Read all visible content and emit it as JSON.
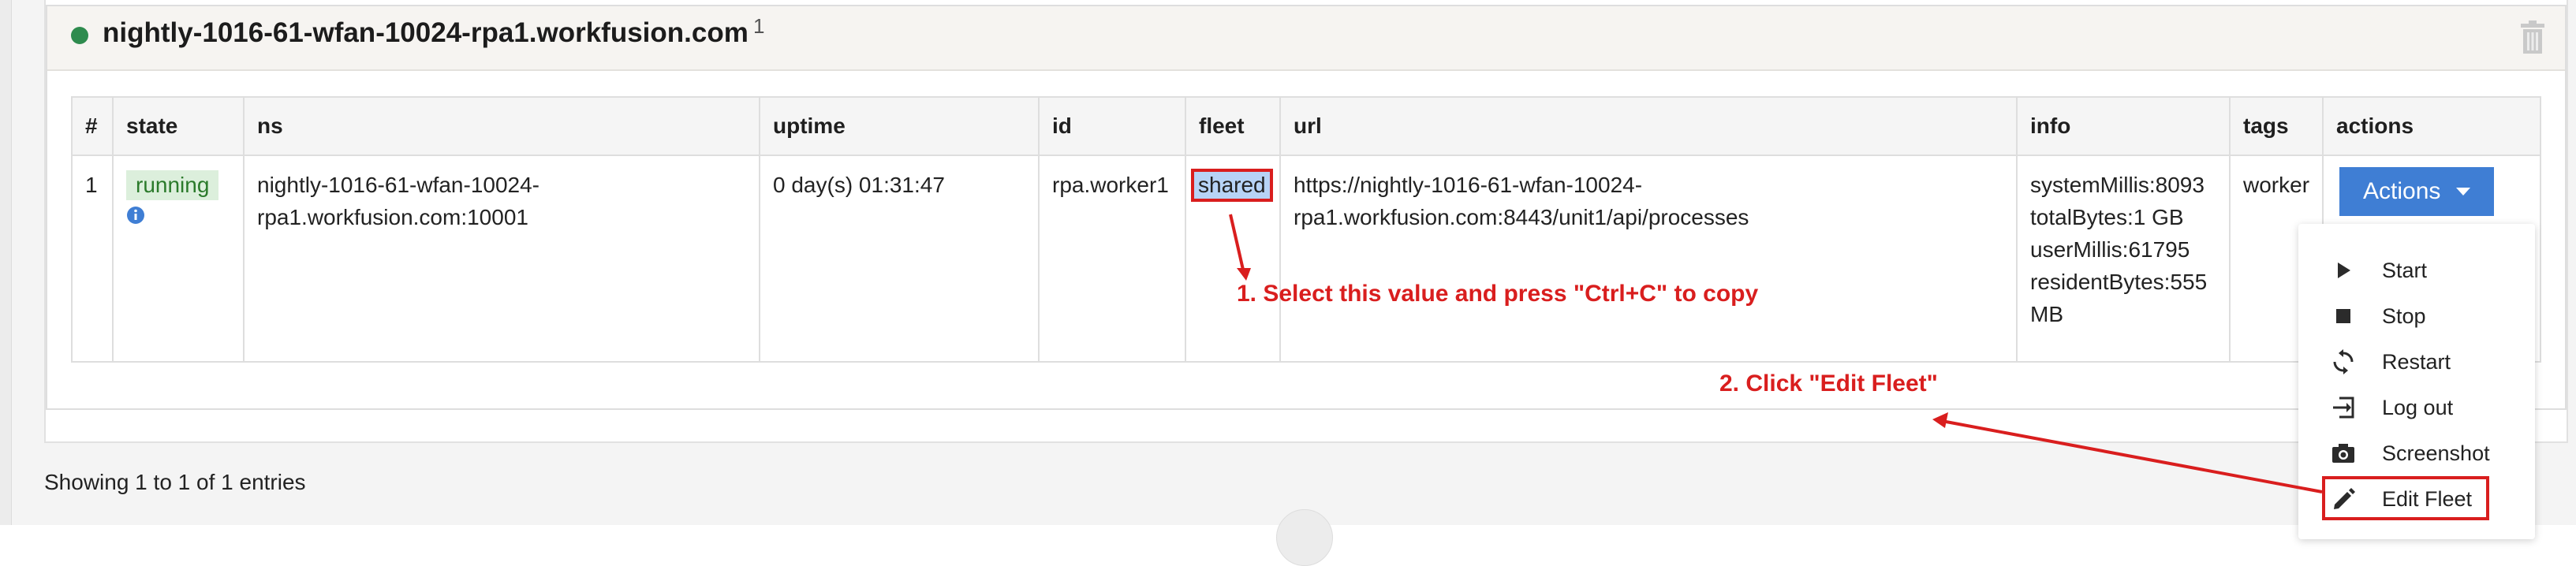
{
  "header": {
    "host": "nightly-1016-61-wfan-10024-rpa1.workfusion.com",
    "count": "1"
  },
  "table": {
    "headers": [
      "#",
      "state",
      "ns",
      "uptime",
      "id",
      "fleet",
      "url",
      "info",
      "tags",
      "actions"
    ],
    "row": {
      "num": "1",
      "state": "running",
      "ns": "nightly-1016-61-wfan-10024-rpa1.workfusion.com:10001",
      "uptime": "0 day(s) 01:31:47",
      "id": "rpa.worker1",
      "fleet": "shared",
      "url": "https://nightly-1016-61-wfan-10024-rpa1.workfusion.com:8443/unit1/api/processes",
      "info": [
        "systemMillis:8093",
        "totalBytes:1 GB",
        "userMillis:61795",
        "residentBytes:555 MB"
      ],
      "tags": "worker",
      "actions_label": "Actions"
    }
  },
  "menu": {
    "items": [
      {
        "label": "Start",
        "icon": "play-icon"
      },
      {
        "label": "Stop",
        "icon": "stop-icon"
      },
      {
        "label": "Restart",
        "icon": "restart-icon"
      },
      {
        "label": "Log out",
        "icon": "logout-icon"
      },
      {
        "label": "Screenshot",
        "icon": "camera-icon"
      },
      {
        "label": "Edit Fleet",
        "icon": "pencil-icon"
      }
    ]
  },
  "footer": {
    "showing": "Showing 1 to 1 of 1 entries"
  },
  "annotations": {
    "step1": "1. Select this value and press \"Ctrl+C\" to copy",
    "step2": "2. Click \"Edit Fleet\""
  },
  "colors": {
    "accent": "#3f7ed4",
    "annotation": "#d91e1e",
    "running_bg": "#dcefdc",
    "running_text": "#2b7a2b",
    "status_dot": "#2e8b4e"
  }
}
